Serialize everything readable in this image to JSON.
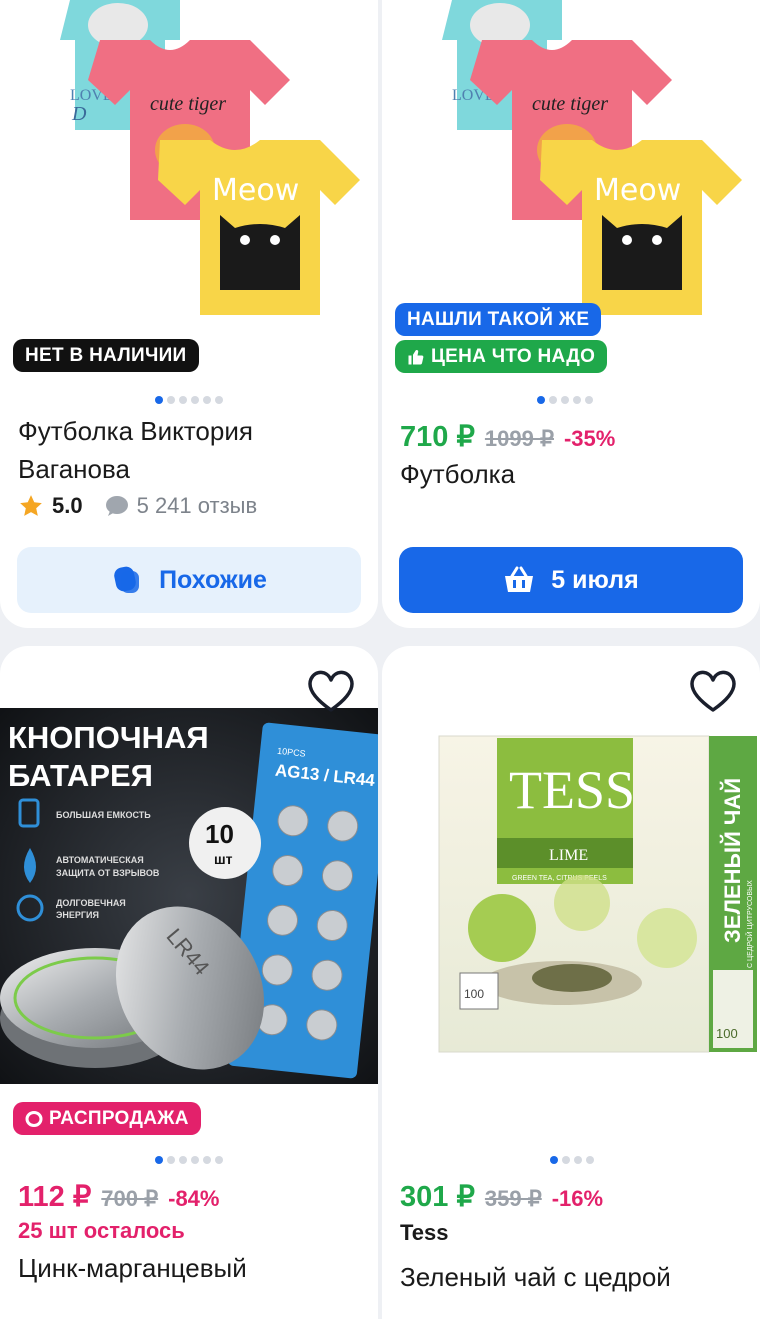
{
  "cards": [
    {
      "badge": "НЕТ В НАЛИЧИИ",
      "title_line1": "Футболка Виктория",
      "title_line2": "Ваганова",
      "rating": "5.0",
      "reviews": "5 241 отзыв",
      "button_label": "Похожие",
      "shirt_texts": [
        "cute tiger",
        "Meow",
        "LOVE"
      ]
    },
    {
      "badge_1": "НАШЛИ ТАКОЙ ЖЕ",
      "badge_2": "ЦЕНА ЧТО НАДО",
      "price": "710 ₽",
      "old_price": "1099 ₽",
      "discount": "-35%",
      "title": "Футболка",
      "button_label": "5 июля",
      "shirt_texts": [
        "cute tiger",
        "Meow",
        "LOVE"
      ]
    },
    {
      "image_title": "КНОПОЧНАЯ\nБАТАРЕЯ",
      "image_title_1": "КНОПОЧНАЯ",
      "image_title_2": "БАТАРЕЯ",
      "pack_label": "AG13 / LR44",
      "pack_count": "10PCS",
      "count_badge_num": "10",
      "count_badge_unit": "шт",
      "features": [
        "БОЛЬШАЯ ЕМКОСТЬ",
        "АВТОМАТИЧЕСКАЯ ЗАЩИТА ОТ ВЗРЫВОВ",
        "ДОЛГОВЕЧНАЯ ЭНЕРГИЯ"
      ],
      "cell_marking": "LR44",
      "badge": "РАСПРОДАЖА",
      "price": "112 ₽",
      "old_price": "700 ₽",
      "discount": "-84%",
      "stock": "25 шт осталось",
      "title": "Цинк-марганцевый"
    },
    {
      "brand_logo": "TESS",
      "flavor": "LIME",
      "flavor_sub": "GREEN TEA, CITRUS PEELS",
      "side_label": "ЗЕЛЕНЫЙ ЧАЙ",
      "side_sub": "С ЦЕДРОЙ ЦИТРУСОВЫХ",
      "bag_count": "100",
      "price": "301 ₽",
      "old_price": "359 ₽",
      "discount": "-16%",
      "brand": "Tess",
      "title": "Зеленый чай с цедрой"
    }
  ],
  "colors": {
    "blue": "#1868e8",
    "green": "#1fa84a",
    "pink": "#e3216b",
    "black_badge": "#111111",
    "similar_btn_bg": "#e6f1fc"
  }
}
